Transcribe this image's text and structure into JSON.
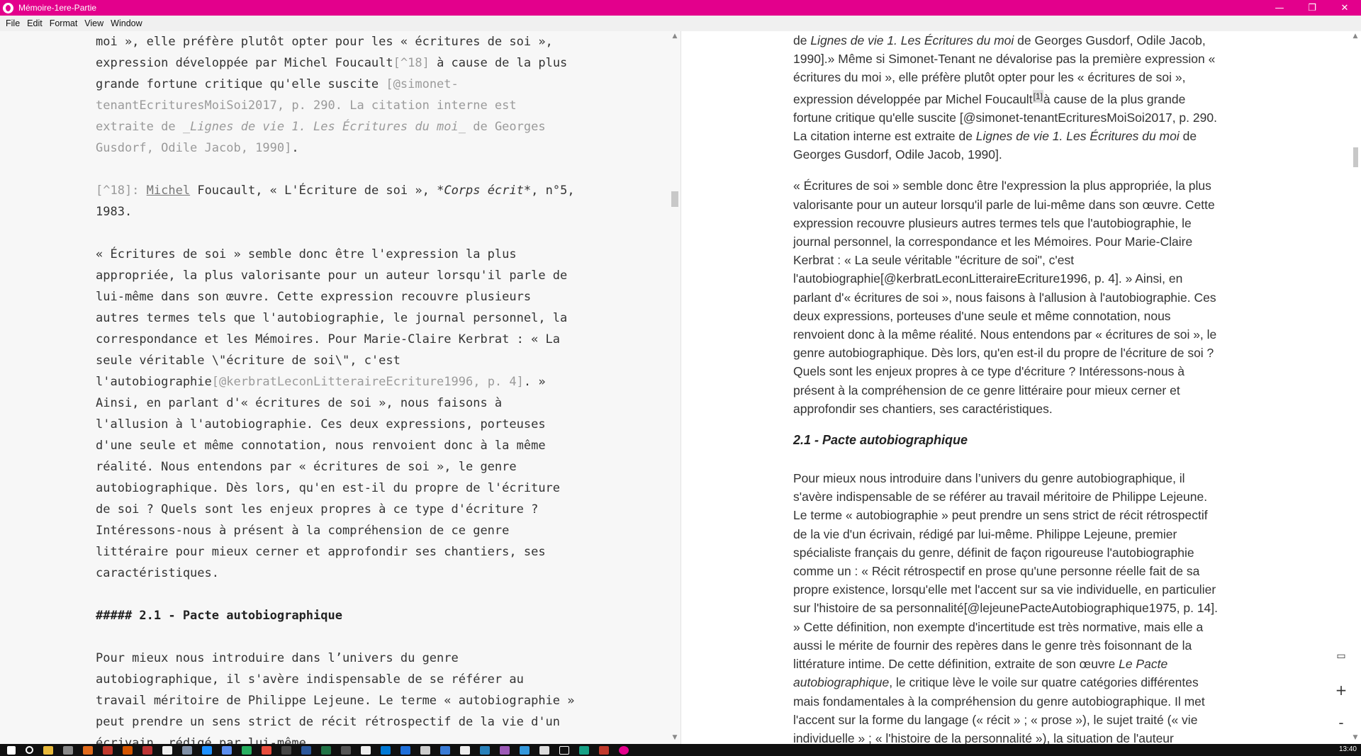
{
  "window": {
    "title": "Mémoire-1ere-Partie",
    "controls": {
      "minimize": "—",
      "maximize": "❐",
      "close": "✕"
    }
  },
  "menu": [
    "File",
    "Edit",
    "Format",
    "View",
    "Window"
  ],
  "editor": {
    "p1_a": "moi », elle préfère plutôt opter pour les « écritures de soi », expression développée par Michel Foucault",
    "p1_ref": "[^18]",
    "p1_b": " à cause de la plus grande fortune critique qu'elle suscite ",
    "p1_cite1": "[@simonet-tenantEcrituresMoiSoi2017, p. 290. La citation interne est extraite de ",
    "p1_cite_ital": "_Lignes de vie 1. Les Écritures du moi_",
    "p1_cite2": " de Georges Gusdorf, Odile Jacob, 1990]",
    "p1_end": ".",
    "fn_label": "[^18]:",
    "fn_name": "Michel",
    "fn_a": " Foucault, « L'Écriture de soi », ",
    "fn_ital": "*Corps écrit*",
    "fn_b": ", n°5, 1983.",
    "p2_a": "« Écritures de soi » semble donc être l'expression la plus appropriée, la plus valorisante pour un auteur lorsqu'il parle de lui-même dans son œuvre. Cette expression recouvre plusieurs autres termes tels que l'autobiographie, le journal personnel, la correspondance et les Mémoires. Pour Marie-Claire Kerbrat : « La seule véritable \\\"écriture de soi\\\", c'est l'autobiographie",
    "p2_cite": "[@kerbratLeconLitteraireEcriture1996, p. 4]",
    "p2_b": ". » Ainsi, en parlant d'« écritures de soi », nous faisons à l'allusion à l'autobiographie. Ces deux expressions, porteuses d'une seule et même connotation, nous renvoient donc à la même réalité. Nous entendons par « écritures de soi », le genre autobiographique. Dès lors, qu'en est-il du propre de l'écriture de soi ? Quels sont les enjeux propres à ce type d'écriture ? Intéressons-nous à présent à la compréhension de ce genre littéraire pour mieux cerner et approfondir ses chantiers, ses caractéristiques.",
    "heading": "##### 2.1 - Pacte autobiographique",
    "p3": "Pour mieux nous introduire dans l’univers du genre autobiographique, il s'avère indispensable de se référer au travail méritoire de Philippe Lejeune. Le terme « autobiographie » peut prendre un sens strict de récit rétrospectif de la vie d'un écrivain, rédigé par lui-même."
  },
  "preview": {
    "p1_a": "de ",
    "p1_ital": "Lignes de vie 1. Les Écritures du moi",
    "p1_b": " de Georges Gusdorf, Odile Jacob, 1990].» Même si Simonet-Tenant ne dévalorise pas la première expression « écritures du moi », elle préfère plutôt opter pour les « écritures de soi », expression développée par Michel Foucault",
    "p1_fn": "[1]",
    "p1_c": "à cause de la plus grande fortune critique qu'elle suscite [@simonet-tenantEcrituresMoiSoi2017, p. 290. La citation interne est extraite de ",
    "p1_ital2": "Lignes de vie 1. Les Écritures du moi",
    "p1_d": " de Georges Gusdorf, Odile Jacob, 1990].",
    "p2": "« Écritures de soi » semble donc être l'expression la plus appropriée, la plus valorisante pour un auteur lorsqu'il parle de lui-même dans son œuvre. Cette expression recouvre plusieurs autres termes tels que l'autobiographie, le journal personnel, la correspondance et les Mémoires. Pour Marie-Claire Kerbrat : « La seule véritable \"écriture de soi\", c'est l'autobiographie[@kerbratLeconLitteraireEcriture1996, p. 4]. » Ainsi, en parlant d'« écritures de soi », nous faisons à l'allusion à l'autobiographie. Ces deux expressions, porteuses d'une seule et même connotation, nous renvoient donc à la même réalité. Nous entendons par « écritures de soi », le genre autobiographique. Dès lors, qu'en est-il du propre de l'écriture de soi ? Quels sont les enjeux propres à ce type d'écriture ? Intéressons-nous à présent à la compréhension de ce genre littéraire pour mieux cerner et approfondir ses chantiers, ses caractéristiques.",
    "heading": "2.1 - Pacte autobiographique",
    "p3_a": "Pour mieux nous introduire dans l’univers du genre autobiographique, il s'avère indispensable de se référer au travail méritoire de Philippe Lejeune. Le terme « autobiographie » peut prendre un sens strict de récit rétrospectif de la vie d'un écrivain, rédigé par lui-même. Philippe Lejeune, premier spécialiste français du genre, définit de façon rigoureuse l'autobiographie comme un : « Récit rétrospectif en prose qu'une personne réelle fait de sa propre existence, lorsqu'elle met l'accent sur sa vie individuelle, en particulier sur l'histoire de sa personnalité[@lejeunePacteAutobiographique1975, p. 14]. » Cette définition, non exempte d'incertitude est très normative, mais elle a aussi le mérite de fournir des repères dans le genre très foisonnant de la littérature intime. De cette définition, extraite de son œuvre ",
    "p3_ital": "Le Pacte autobiographique",
    "p3_b": ", le critique lève le voile sur quatre catégories différentes mais fondamentales à la compréhension du genre autobiographique. Il met l'accent sur la forme du langage (« récit » ; « prose »), le sujet traité (« vie individuelle » ; « l'histoire de la personnalité »), la situation de l'auteur (identité de l'auteur -- dont le nom renvoie à une personne réelle -- et du"
  },
  "side_tools": {
    "doc": "▭",
    "zoom_in": "+",
    "zoom_out": "-"
  },
  "taskbar": {
    "clock": "13:40"
  },
  "colors": {
    "titlebar": "#e3008c",
    "taskbar": "#101010"
  }
}
